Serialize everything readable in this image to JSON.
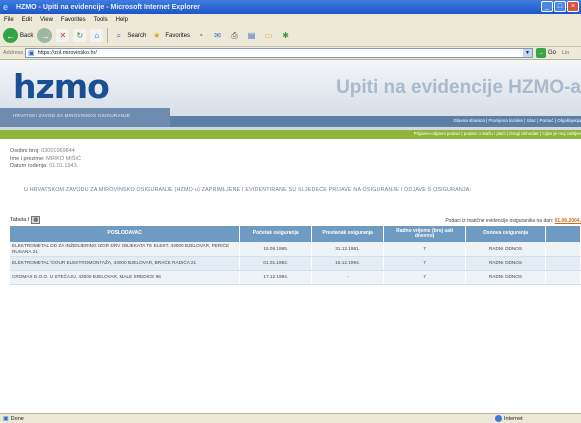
{
  "window": {
    "title": "HZMO - Upiti na evidencije - Microsoft Internet Explorer",
    "buttons": [
      "_",
      "□",
      "×"
    ]
  },
  "menubar": {
    "items": [
      "File",
      "Edit",
      "View",
      "Favorites",
      "Tools",
      "Help"
    ]
  },
  "toolbar": {
    "back_label": "Back",
    "search_label": "Search",
    "favorites_label": "Favorites"
  },
  "address": {
    "label": "Address",
    "url": "https://zol.mirovinsko.hr/",
    "go_label": "Go",
    "links_label": "Lin"
  },
  "header": {
    "logo": "hzmo",
    "logo_sub": "HRVATSKI ZAVOD ZA MIROVINSKO OSIGURANJE",
    "title": "Upiti na evidencije HZMO-a",
    "nav_primary": "Glavna stranica  |  Promjena lozinke  |  Izlaz  |  Pomoć  |  Objašnjenja",
    "nav_secondary": "Prijavno-odjavni podaci  |  podaci o stažu i plaći  |  Drugi dohodak  |  Cijke je moj zahtjev"
  },
  "info": {
    "oib_label": "Osobni broj:",
    "oib_value": "03001069844",
    "name_label": "Ime i prezime:",
    "name_value": "MIRKO MIŠIĆ",
    "dob_label": "Datum rođenja:",
    "dob_value": "01.01.1943."
  },
  "notice": "U HRVATSKOM ZAVODU ZA MIROVINSKO OSIGURANJE (HZMO-u) ZAPRIMLJENE I EVIDENTIRANE SU SLJEDEĆE PRIJAVE NA OSIGURANJE I ODJAVE S OSIGURANJA:",
  "tabela": {
    "label": "Tabela I",
    "podaci_text": "Podaci iz matične evidencije osiguranika na dan: ",
    "podaci_date": "01.06.2004."
  },
  "table": {
    "headers": [
      "POSLODAVAC",
      "Početak osiguranja",
      "Prestanak osiguranja",
      "Radno vrijeme (broj sati dnevno)",
      "Osnova osiguranja"
    ],
    "rows": [
      [
        "ELEKTROMETAL DD ZA INŽENJERING IZGR DRV OBJEKATA TE ELEKT. 43000 BJELOVAR, PERIĆE RUSANA 21",
        "15.09.1965.",
        "31.12.1981.",
        "7",
        "RADNI ODNOS"
      ],
      [
        "ELEKTROMETAL 'OOUR ELEKTROMONTAŽA, 43000 BJELOVAR, BRAĆE RADIĆA 21",
        "01.01.1982.",
        "16.12.1994.",
        "7",
        "RADNI ODNOS"
      ],
      [
        "CROMAX D.O.O. U STEČAJU, 43000 BJELOVAR, MALE SREDICE 66",
        "17.12.1994.",
        "-",
        "7",
        "RADNI ODNOS"
      ]
    ]
  },
  "status": {
    "done": "Done",
    "zone": "Internet"
  }
}
